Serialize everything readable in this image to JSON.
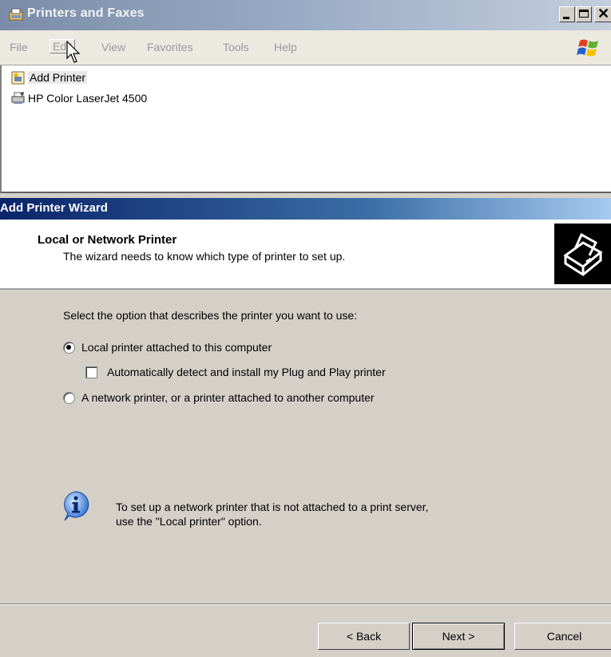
{
  "window": {
    "title": "Printers and Faxes",
    "menu": [
      "File",
      "Edit",
      "View",
      "Favorites",
      "Tools",
      "Help"
    ],
    "items": [
      {
        "label": "Add Printer",
        "icon": "add-printer-icon"
      },
      {
        "label": "HP Color LaserJet 4500",
        "icon": "printer-icon"
      }
    ],
    "controls": {
      "minimize": "minimize-icon",
      "maximize": "maximize-icon",
      "close": "close-icon"
    }
  },
  "wizard": {
    "title": "Add Printer Wizard",
    "header_title": "Local or Network Printer",
    "header_subtitle": "The wizard needs to know which type of printer to set up.",
    "instruction": "Select the option that describes the printer you want to use:",
    "options": {
      "local": {
        "label": "Local printer attached to this computer",
        "checked": true
      },
      "autodetect": {
        "label": "Automatically detect and install my Plug and Play printer",
        "checked": false
      },
      "network": {
        "label": "A network printer, or a printer attached to another computer",
        "checked": false
      }
    },
    "info_line1": "To set up a network printer that is not attached to a print server,",
    "info_line2": "use the \"Local printer\" option.",
    "buttons": {
      "back": "< Back",
      "next": "Next >",
      "cancel": "Cancel"
    }
  },
  "colors": {
    "wizard_title_start": "#0a246a",
    "wizard_title_end": "#a6caf0",
    "dialog_bg": "#d4d0c8"
  }
}
